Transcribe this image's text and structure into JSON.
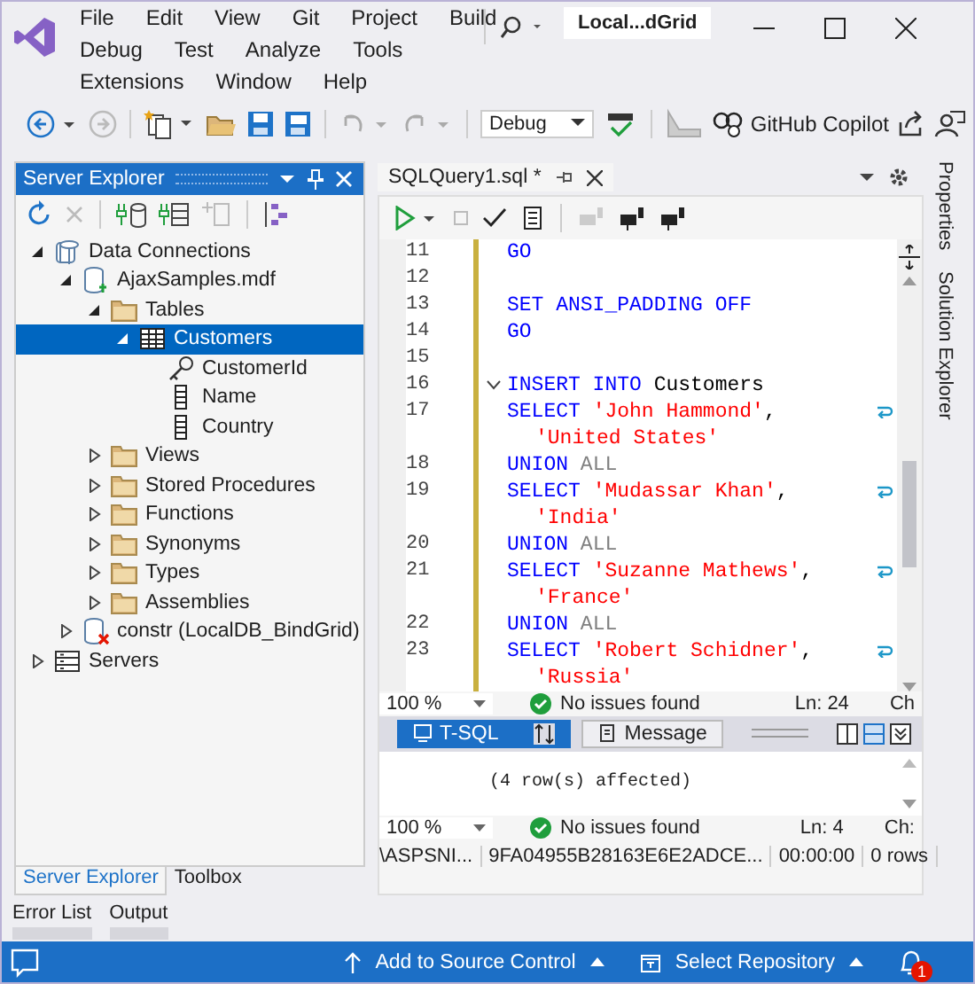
{
  "title_bar": {
    "menus": [
      [
        "File",
        "Edit",
        "View",
        "Git",
        "Project",
        "Build"
      ],
      [
        "Debug",
        "Test",
        "Analyze",
        "Tools"
      ],
      [
        "Extensions",
        "Window",
        "Help"
      ]
    ],
    "solution": "Local...dGrid"
  },
  "toolbar": {
    "configuration": "Debug",
    "copilot": "GitHub Copilot"
  },
  "server_explorer": {
    "title": "Server Explorer",
    "tree": [
      {
        "label": "Data Connections",
        "kind": "connections",
        "expanded": true,
        "selected": false,
        "children": [
          {
            "label": "AjaxSamples.mdf",
            "kind": "database",
            "expanded": true,
            "selected": false,
            "children": [
              {
                "label": "Tables",
                "kind": "folder",
                "expanded": true,
                "selected": false,
                "children": [
                  {
                    "label": "Customers",
                    "kind": "table",
                    "expanded": true,
                    "selected": true,
                    "children": [
                      {
                        "label": "CustomerId",
                        "kind": "key",
                        "selected": false
                      },
                      {
                        "label": "Name",
                        "kind": "column",
                        "selected": false
                      },
                      {
                        "label": "Country",
                        "kind": "column",
                        "selected": false
                      }
                    ]
                  }
                ]
              },
              {
                "label": "Views",
                "kind": "folder",
                "expanded": false,
                "selected": false
              },
              {
                "label": "Stored Procedures",
                "kind": "folder",
                "expanded": false,
                "selected": false
              },
              {
                "label": "Functions",
                "kind": "folder",
                "expanded": false,
                "selected": false
              },
              {
                "label": "Synonyms",
                "kind": "folder",
                "expanded": false,
                "selected": false
              },
              {
                "label": "Types",
                "kind": "folder",
                "expanded": false,
                "selected": false
              },
              {
                "label": "Assemblies",
                "kind": "folder",
                "expanded": false,
                "selected": false
              }
            ]
          },
          {
            "label": "constr (LocalDB_BindGrid)",
            "kind": "database-error",
            "expanded": false,
            "selected": false
          }
        ]
      },
      {
        "label": "Servers",
        "kind": "servers",
        "expanded": false,
        "selected": false
      }
    ],
    "tabs": [
      {
        "label": "Server Explorer",
        "selected": true
      },
      {
        "label": "Toolbox",
        "selected": false
      }
    ]
  },
  "editor": {
    "tab": "SQLQuery1.sql *",
    "lines": [
      {
        "number": "11",
        "fold": false,
        "tokens": [
          {
            "kind": "keyword",
            "text": "GO"
          }
        ]
      },
      {
        "number": "12",
        "fold": false
      },
      {
        "number": "13",
        "fold": false,
        "tokens": [
          {
            "kind": "keyword",
            "text": "SET ANSI_PADDING OFF"
          }
        ]
      },
      {
        "number": "14",
        "fold": false,
        "tokens": [
          {
            "kind": "keyword",
            "text": "GO"
          }
        ]
      },
      {
        "number": "15",
        "fold": false
      },
      {
        "number": "16",
        "fold": true,
        "tokens": [
          {
            "kind": "keyword",
            "text": "INSERT INTO"
          },
          {
            "kind": "plain",
            "text": "Customers"
          }
        ]
      },
      {
        "number": "17",
        "fold": false,
        "tokens": [
          {
            "kind": "keyword",
            "text": "SELECT"
          },
          {
            "kind": "string",
            "text": "'John Hammond'"
          },
          {
            "kind": "punct",
            "text": ","
          }
        ]
      },
      {
        "fold": false,
        "tokens": [
          {
            "kind": "string",
            "text": "'United States'"
          }
        ]
      },
      {
        "number": "18",
        "fold": false,
        "tokens": [
          {
            "kind": "keyword",
            "text": "UNION"
          },
          {
            "kind": "operator",
            "text": "ALL"
          }
        ]
      },
      {
        "number": "19",
        "fold": false,
        "tokens": [
          {
            "kind": "keyword",
            "text": "SELECT"
          },
          {
            "kind": "string",
            "text": "'Mudassar Khan'"
          },
          {
            "kind": "punct",
            "text": ","
          }
        ]
      },
      {
        "fold": false,
        "tokens": [
          {
            "kind": "string",
            "text": "'India'"
          }
        ]
      },
      {
        "number": "20",
        "fold": false,
        "tokens": [
          {
            "kind": "keyword",
            "text": "UNION"
          },
          {
            "kind": "operator",
            "text": "ALL"
          }
        ]
      },
      {
        "number": "21",
        "fold": false,
        "tokens": [
          {
            "kind": "keyword",
            "text": "SELECT"
          },
          {
            "kind": "string",
            "text": "'Suzanne Mathews'"
          },
          {
            "kind": "punct",
            "text": ","
          }
        ]
      },
      {
        "fold": false,
        "tokens": [
          {
            "kind": "string",
            "text": "'France'"
          }
        ]
      },
      {
        "number": "22",
        "fold": false,
        "tokens": [
          {
            "kind": "keyword",
            "text": "UNION"
          },
          {
            "kind": "operator",
            "text": "ALL"
          }
        ]
      },
      {
        "number": "23",
        "fold": false,
        "tokens": [
          {
            "kind": "keyword",
            "text": "SELECT"
          },
          {
            "kind": "string",
            "text": "'Robert Schidner'"
          },
          {
            "kind": "punct",
            "text": ","
          }
        ]
      },
      {
        "fold": false,
        "tokens": [
          {
            "kind": "string",
            "text": "'Russia'"
          }
        ]
      }
    ],
    "zoom": "100 %",
    "issues": "No issues found",
    "position": "Ln: 24",
    "column": "Ch"
  },
  "results": {
    "tabs": [
      {
        "label": "T-SQL",
        "selected": true
      },
      {
        "label": "Message",
        "selected": false
      }
    ],
    "message": "(4 row(s) affected)",
    "zoom": "100 %",
    "issues": "No issues found",
    "position": "Ln: 4",
    "column": "Ch:",
    "connection": [
      "\\ASPSNI...",
      "9FA04955B28163E6E2ADCE...",
      "00:00:00",
      "0 rows"
    ]
  },
  "side_tabs": [
    "Properties",
    "Solution Explorer"
  ],
  "bottom_tabs": [
    "Error List",
    "Output"
  ],
  "status_bar": {
    "source_control": "Add to Source Control",
    "repository": "Select Repository",
    "notifications": "1"
  }
}
